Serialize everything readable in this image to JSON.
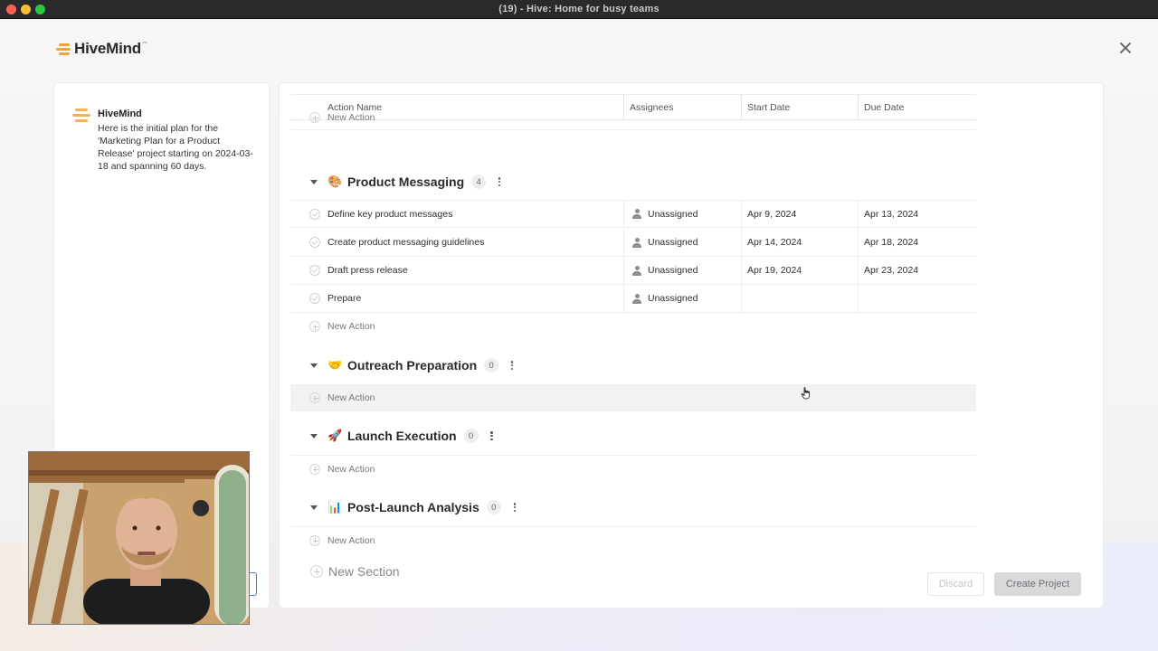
{
  "window": {
    "title": "(19) - Hive: Home for busy teams"
  },
  "brand": {
    "name": "HiveMind",
    "accent": "#f2a33a"
  },
  "chat": {
    "sender": "HiveMind",
    "message": "Here is the initial plan for the 'Marketing Plan for a Product Release' project starting on 2024-03-18 and spanning 60 days."
  },
  "table": {
    "headers": [
      "Action Name",
      "Assignees",
      "Start Date",
      "Due Date"
    ]
  },
  "new_action_label": "New Action",
  "sections": [
    {
      "emoji": "🎨",
      "title": "Product Messaging",
      "count": "4",
      "rows": [
        {
          "name": "Define key product messages",
          "assignee": "Unassigned",
          "start": "Apr 9, 2024",
          "due": "Apr 13, 2024"
        },
        {
          "name": "Create product messaging guidelines",
          "assignee": "Unassigned",
          "start": "Apr 14, 2024",
          "due": "Apr 18, 2024"
        },
        {
          "name": "Draft press release",
          "assignee": "Unassigned",
          "start": "Apr 19, 2024",
          "due": "Apr 23, 2024"
        },
        {
          "name": "Prepare",
          "assignee": "Unassigned",
          "start": "",
          "due": ""
        }
      ]
    },
    {
      "emoji": "🤝",
      "title": "Outreach Preparation",
      "count": "0",
      "rows": []
    },
    {
      "emoji": "🚀",
      "title": "Launch Execution",
      "count": "0",
      "rows": []
    },
    {
      "emoji": "📊",
      "title": "Post-Launch Analysis",
      "count": "0",
      "rows": []
    }
  ],
  "new_section_label": "New Section",
  "buttons": {
    "discard": "Discard",
    "create": "Create Project"
  }
}
